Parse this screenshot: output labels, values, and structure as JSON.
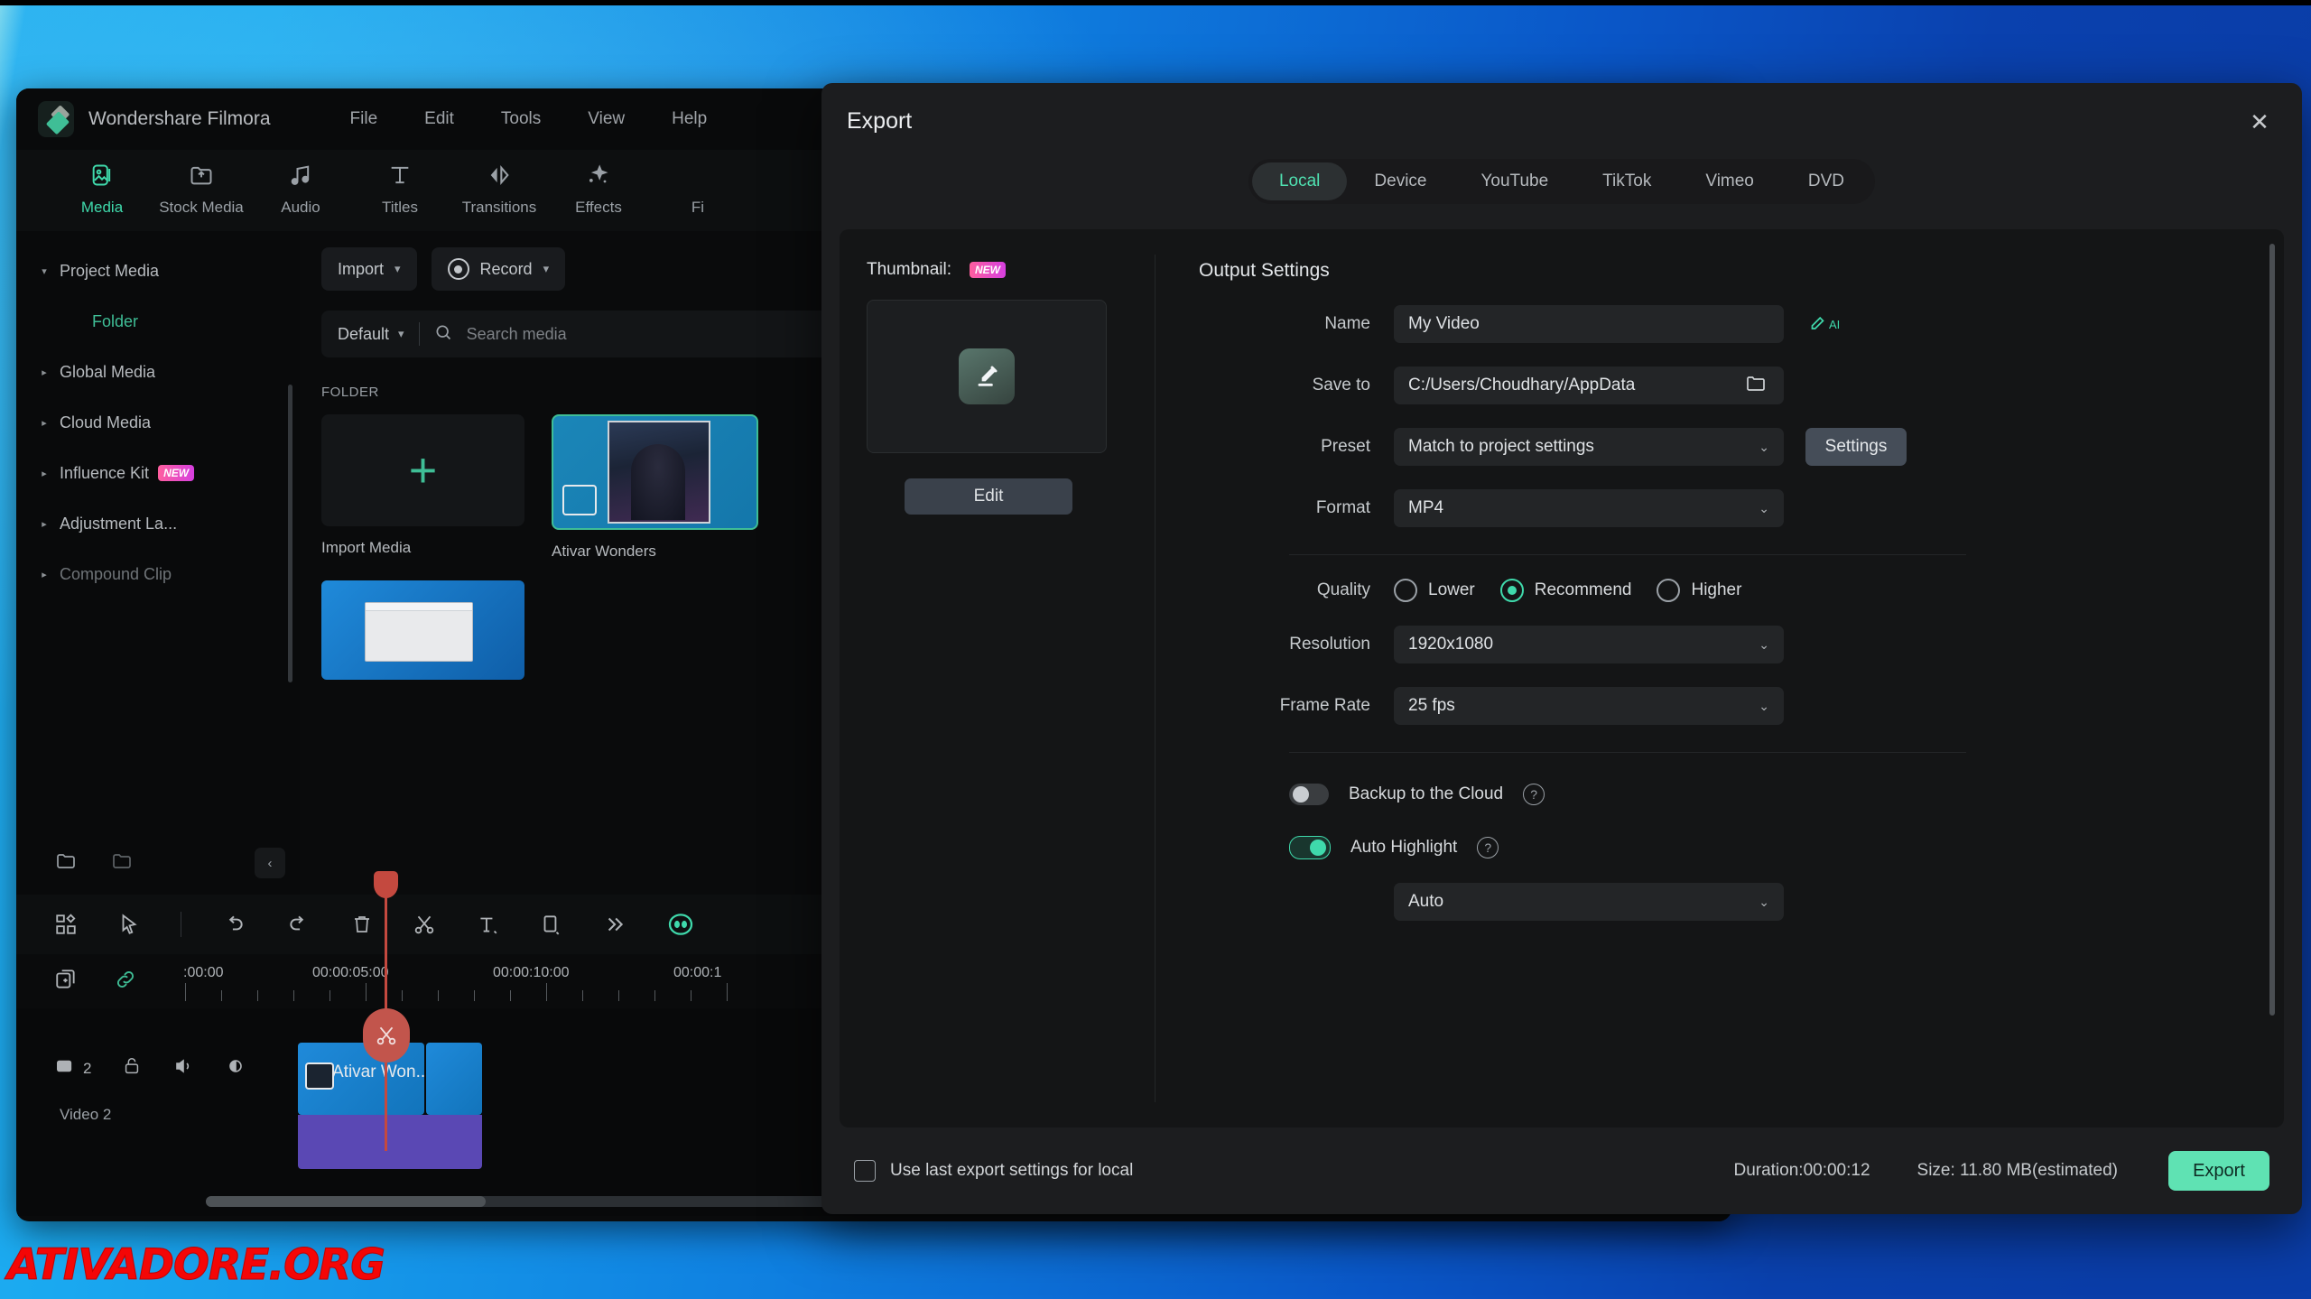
{
  "watermark": "ATIVADORE.ORG",
  "app": {
    "title": "Wondershare Filmora",
    "menu": [
      "File",
      "Edit",
      "Tools",
      "View",
      "Help"
    ],
    "tool_tabs": [
      {
        "label": "Media",
        "icon": "media-icon",
        "active": true
      },
      {
        "label": "Stock Media",
        "icon": "stock-media-icon",
        "active": false
      },
      {
        "label": "Audio",
        "icon": "audio-note-icon",
        "active": false
      },
      {
        "label": "Titles",
        "icon": "titles-text-icon",
        "active": false
      },
      {
        "label": "Transitions",
        "icon": "transitions-icon",
        "active": false
      },
      {
        "label": "Effects",
        "icon": "effects-sparkle-icon",
        "active": false
      },
      {
        "label": "Fi",
        "icon": "filters-icon",
        "active": false
      }
    ],
    "sidebar": [
      {
        "label": "Project Media",
        "expanded": true,
        "badge": ""
      },
      {
        "label": "Folder",
        "sub": true,
        "badge": ""
      },
      {
        "label": "Global Media",
        "expanded": false,
        "badge": ""
      },
      {
        "label": "Cloud Media",
        "expanded": false,
        "badge": ""
      },
      {
        "label": "Influence Kit",
        "expanded": false,
        "badge": "NEW"
      },
      {
        "label": "Adjustment La...",
        "expanded": false,
        "badge": ""
      },
      {
        "label": "Compound Clip",
        "expanded": false,
        "badge": ""
      }
    ],
    "media_panel": {
      "import_label": "Import",
      "record_label": "Record",
      "sort_label": "Default",
      "search_placeholder": "Search media",
      "folder_header": "FOLDER",
      "tiles": [
        {
          "label": "Import Media"
        },
        {
          "label": "Ativar Wonders"
        }
      ]
    },
    "timeline": {
      "ruler_labels": [
        ":00:00",
        "00:00:05:00",
        "00:00:10:00",
        "00:00:1"
      ],
      "track_name": "Video 2",
      "track_count": "2",
      "clip_label": "Ativar Won..."
    }
  },
  "export_dialog": {
    "title": "Export",
    "close_icon": "close-icon",
    "tabs": [
      {
        "label": "Local",
        "active": true
      },
      {
        "label": "Device",
        "active": false
      },
      {
        "label": "YouTube",
        "active": false
      },
      {
        "label": "TikTok",
        "active": false
      },
      {
        "label": "Vimeo",
        "active": false
      },
      {
        "label": "DVD",
        "active": false
      }
    ],
    "thumbnail": {
      "label": "Thumbnail:",
      "badge": "NEW",
      "edit_button": "Edit",
      "icon": "edit-pencil-icon"
    },
    "output": {
      "section_title": "Output Settings",
      "name_label": "Name",
      "name_value": "My Video",
      "ai_icon_label": "AI",
      "saveto_label": "Save to",
      "saveto_value": "C:/Users/Choudhary/AppData",
      "folder_icon": "folder-icon",
      "preset_label": "Preset",
      "preset_value": "Match to project settings",
      "settings_button": "Settings",
      "format_label": "Format",
      "format_value": "MP4",
      "quality_label": "Quality",
      "quality_options": [
        {
          "label": "Lower",
          "selected": false
        },
        {
          "label": "Recommend",
          "selected": true
        },
        {
          "label": "Higher",
          "selected": false
        }
      ],
      "resolution_label": "Resolution",
      "resolution_value": "1920x1080",
      "framerate_label": "Frame Rate",
      "framerate_value": "25 fps",
      "backup_label": "Backup to the Cloud",
      "backup_on": false,
      "autohighlight_label": "Auto Highlight",
      "autohighlight_on": true,
      "autohighlight_mode": "Auto",
      "help_icon": "question-mark-icon"
    },
    "footer": {
      "checkbox_label": "Use last export settings for local",
      "checkbox_checked": false,
      "duration": "Duration:00:00:12",
      "size": "Size: 11.80 MB(estimated)",
      "export_button": "Export"
    }
  },
  "colors": {
    "accent_teal": "#3fd9ab",
    "export_button": "#5fe2b3",
    "badge_new": "#d63fe0",
    "playhead_red": "#c4493f",
    "watermark_red": "#f40606"
  }
}
